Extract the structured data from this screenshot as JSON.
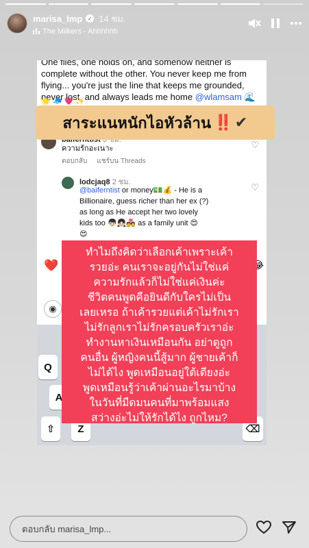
{
  "story": {
    "segments_total": 7,
    "segments_done": 6
  },
  "header": {
    "username": "marisa_lmp",
    "time_ago": "14 ชม.",
    "music_label": "The Milkers - Ahhhhhh"
  },
  "icons": {
    "mute": "speaker-mute-icon",
    "pause": "pause-icon",
    "more": "more-icon",
    "heart": "heart-icon",
    "share": "send-icon"
  },
  "screenshot": {
    "caption_lines": [
      "One flies, one holds on, and somehow neither is",
      "complete without the other. You never keep me from",
      "flying... you're just the line that keeps me grounded,",
      "never lost, and always leads me home"
    ],
    "caption_tag": "@wlamsam",
    "caption_emoji": "🌊",
    "emoji_row": "🌟 🧢 💗 ✨",
    "comment1": {
      "user": "baifernttist",
      "ago": "3 ชม.",
      "text": "ความรักอะเนาะ",
      "reply_label": "ตอบกลับ",
      "share_label": "แชร์บน Threads"
    },
    "comment2": {
      "user": "lodcjaq8",
      "ago": "2 ชม.",
      "mention": "@baiferntist",
      "text_lines": [
        "or money💵💰 - He is a",
        "Billionaire, guess richer than her ex (?)",
        "as long as He accept her two lovely",
        "kids too 👦🏻👧🏻💑 as a family unit 😍",
        "😍"
      ]
    },
    "reaction_heart": "❤️",
    "reaction_laugh": "😂",
    "keys": [
      "Q",
      "A",
      "⇧",
      "Z",
      "⌫"
    ]
  },
  "banner": {
    "text": "สาระแนหนักไอหัวล้าน",
    "bangs": "‼️",
    "check": "✔"
  },
  "overlay_lines": [
    "ทำไมถึงคิดว่าเลือกเค้าเพราะเค้า",
    "รวยอ่ะ คนเราจะอยู่กันไม่ใช่แค่",
    "ความรักแล้วก็ไม่ใช่แค่เงินค่ะ",
    "ชีวิตคนพูดคือยินดีกับใครไม่เป็น",
    "เลยเหรอ ถ้าเค้ารวยแต่เค้าไม่รักเรา",
    "ไม่รักลูกเราไม่รักครอบครัวเราอ่ะ",
    "ทำงานหาเงินเหมือนกัน อย่าดูถูก",
    "คนอื่น ผู้หญิงคนนี้สู้มาก ผู้ชายเค้าก็",
    "ไม่ได้ไง พูดเหมือนอยู่ใต้เตียงอ่ะ",
    "พูดเหมือนรู้ว่าเค้าผ่านอะไรมาบ้าง",
    "ในวันที่มืดมนคนที่มาพร้อมแสง",
    "สว่างอ่ะไม่ให้รักได้ไง ถูกไหม?"
  ],
  "footer": {
    "reply_placeholder": "ตอบกลับ marisa_lmp..."
  }
}
